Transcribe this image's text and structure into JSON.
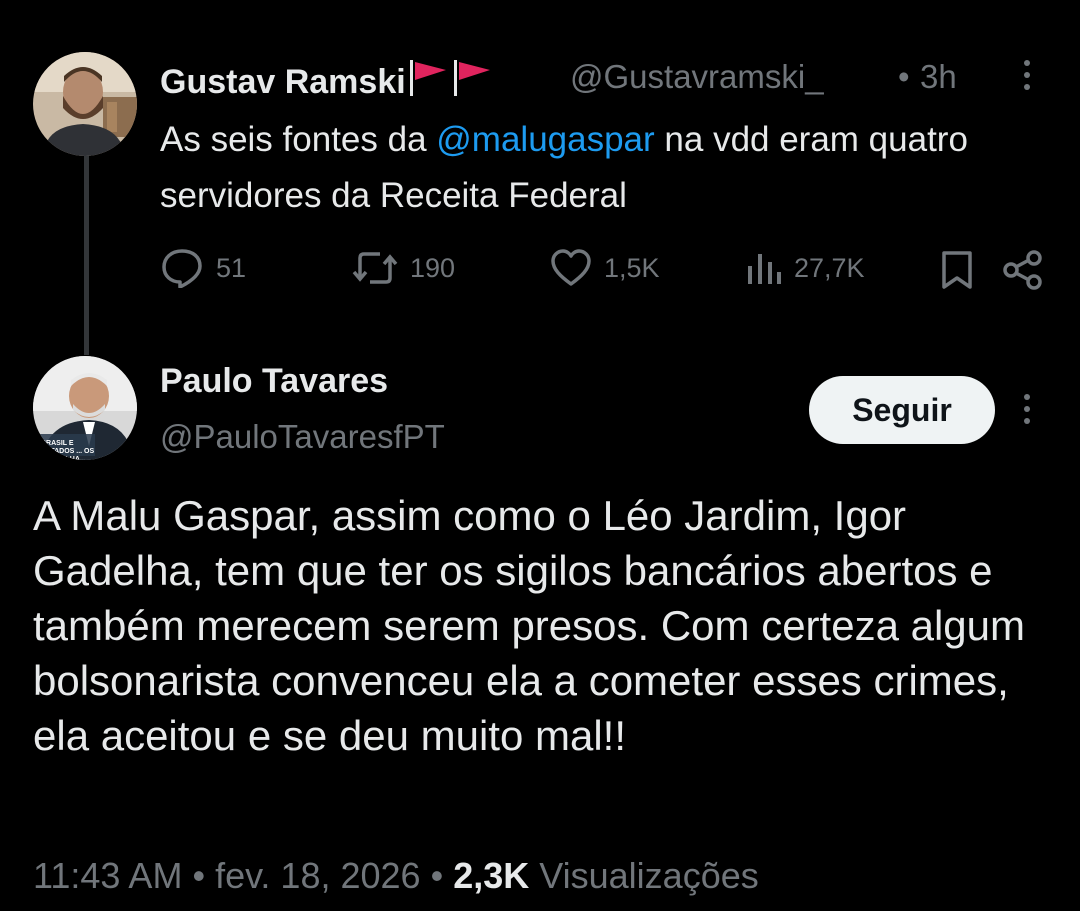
{
  "tweet1": {
    "author_name": "Gustav Ramski",
    "handle": "@Gustavramski_",
    "separator": "•",
    "time": "3h",
    "text_before": "As seis fontes da ",
    "mention": "@malugaspar",
    "text_after": " na vdd eram quatro servidores da Receita Federal",
    "actions": {
      "replies": "51",
      "reposts": "190",
      "likes": "1,5K",
      "views": "27,7K"
    }
  },
  "tweet2": {
    "author_name": "Paulo Tavares",
    "handle": "@PauloTavaresfPT",
    "follow_label": "Seguir",
    "avatar_caption": "BRASIL E ESTADOS ... OS TRABALHA...",
    "text": "A Malu Gaspar, assim como o Léo Jardim, Igor Gadelha, tem que ter os sigilos bancários abertos e também merecem serem presos. Com certeza algum bolsonarista convenceu ela a cometer esses crimes, ela aceitou e se deu muito mal!!",
    "time": "11:43 AM",
    "date": "fev. 18, 2026",
    "separator": "•",
    "view_count": "2,3K",
    "view_label": "Visualizações"
  },
  "colors": {
    "background": "#000000",
    "text": "#e7e9ea",
    "muted": "#71767b",
    "link": "#1d9bf0",
    "flag": "#e0245e",
    "button_bg": "#eff3f4"
  },
  "icons": [
    "more-icon",
    "reply-icon",
    "repost-icon",
    "like-icon",
    "views-icon",
    "bookmark-icon",
    "share-icon",
    "flag-icon"
  ]
}
